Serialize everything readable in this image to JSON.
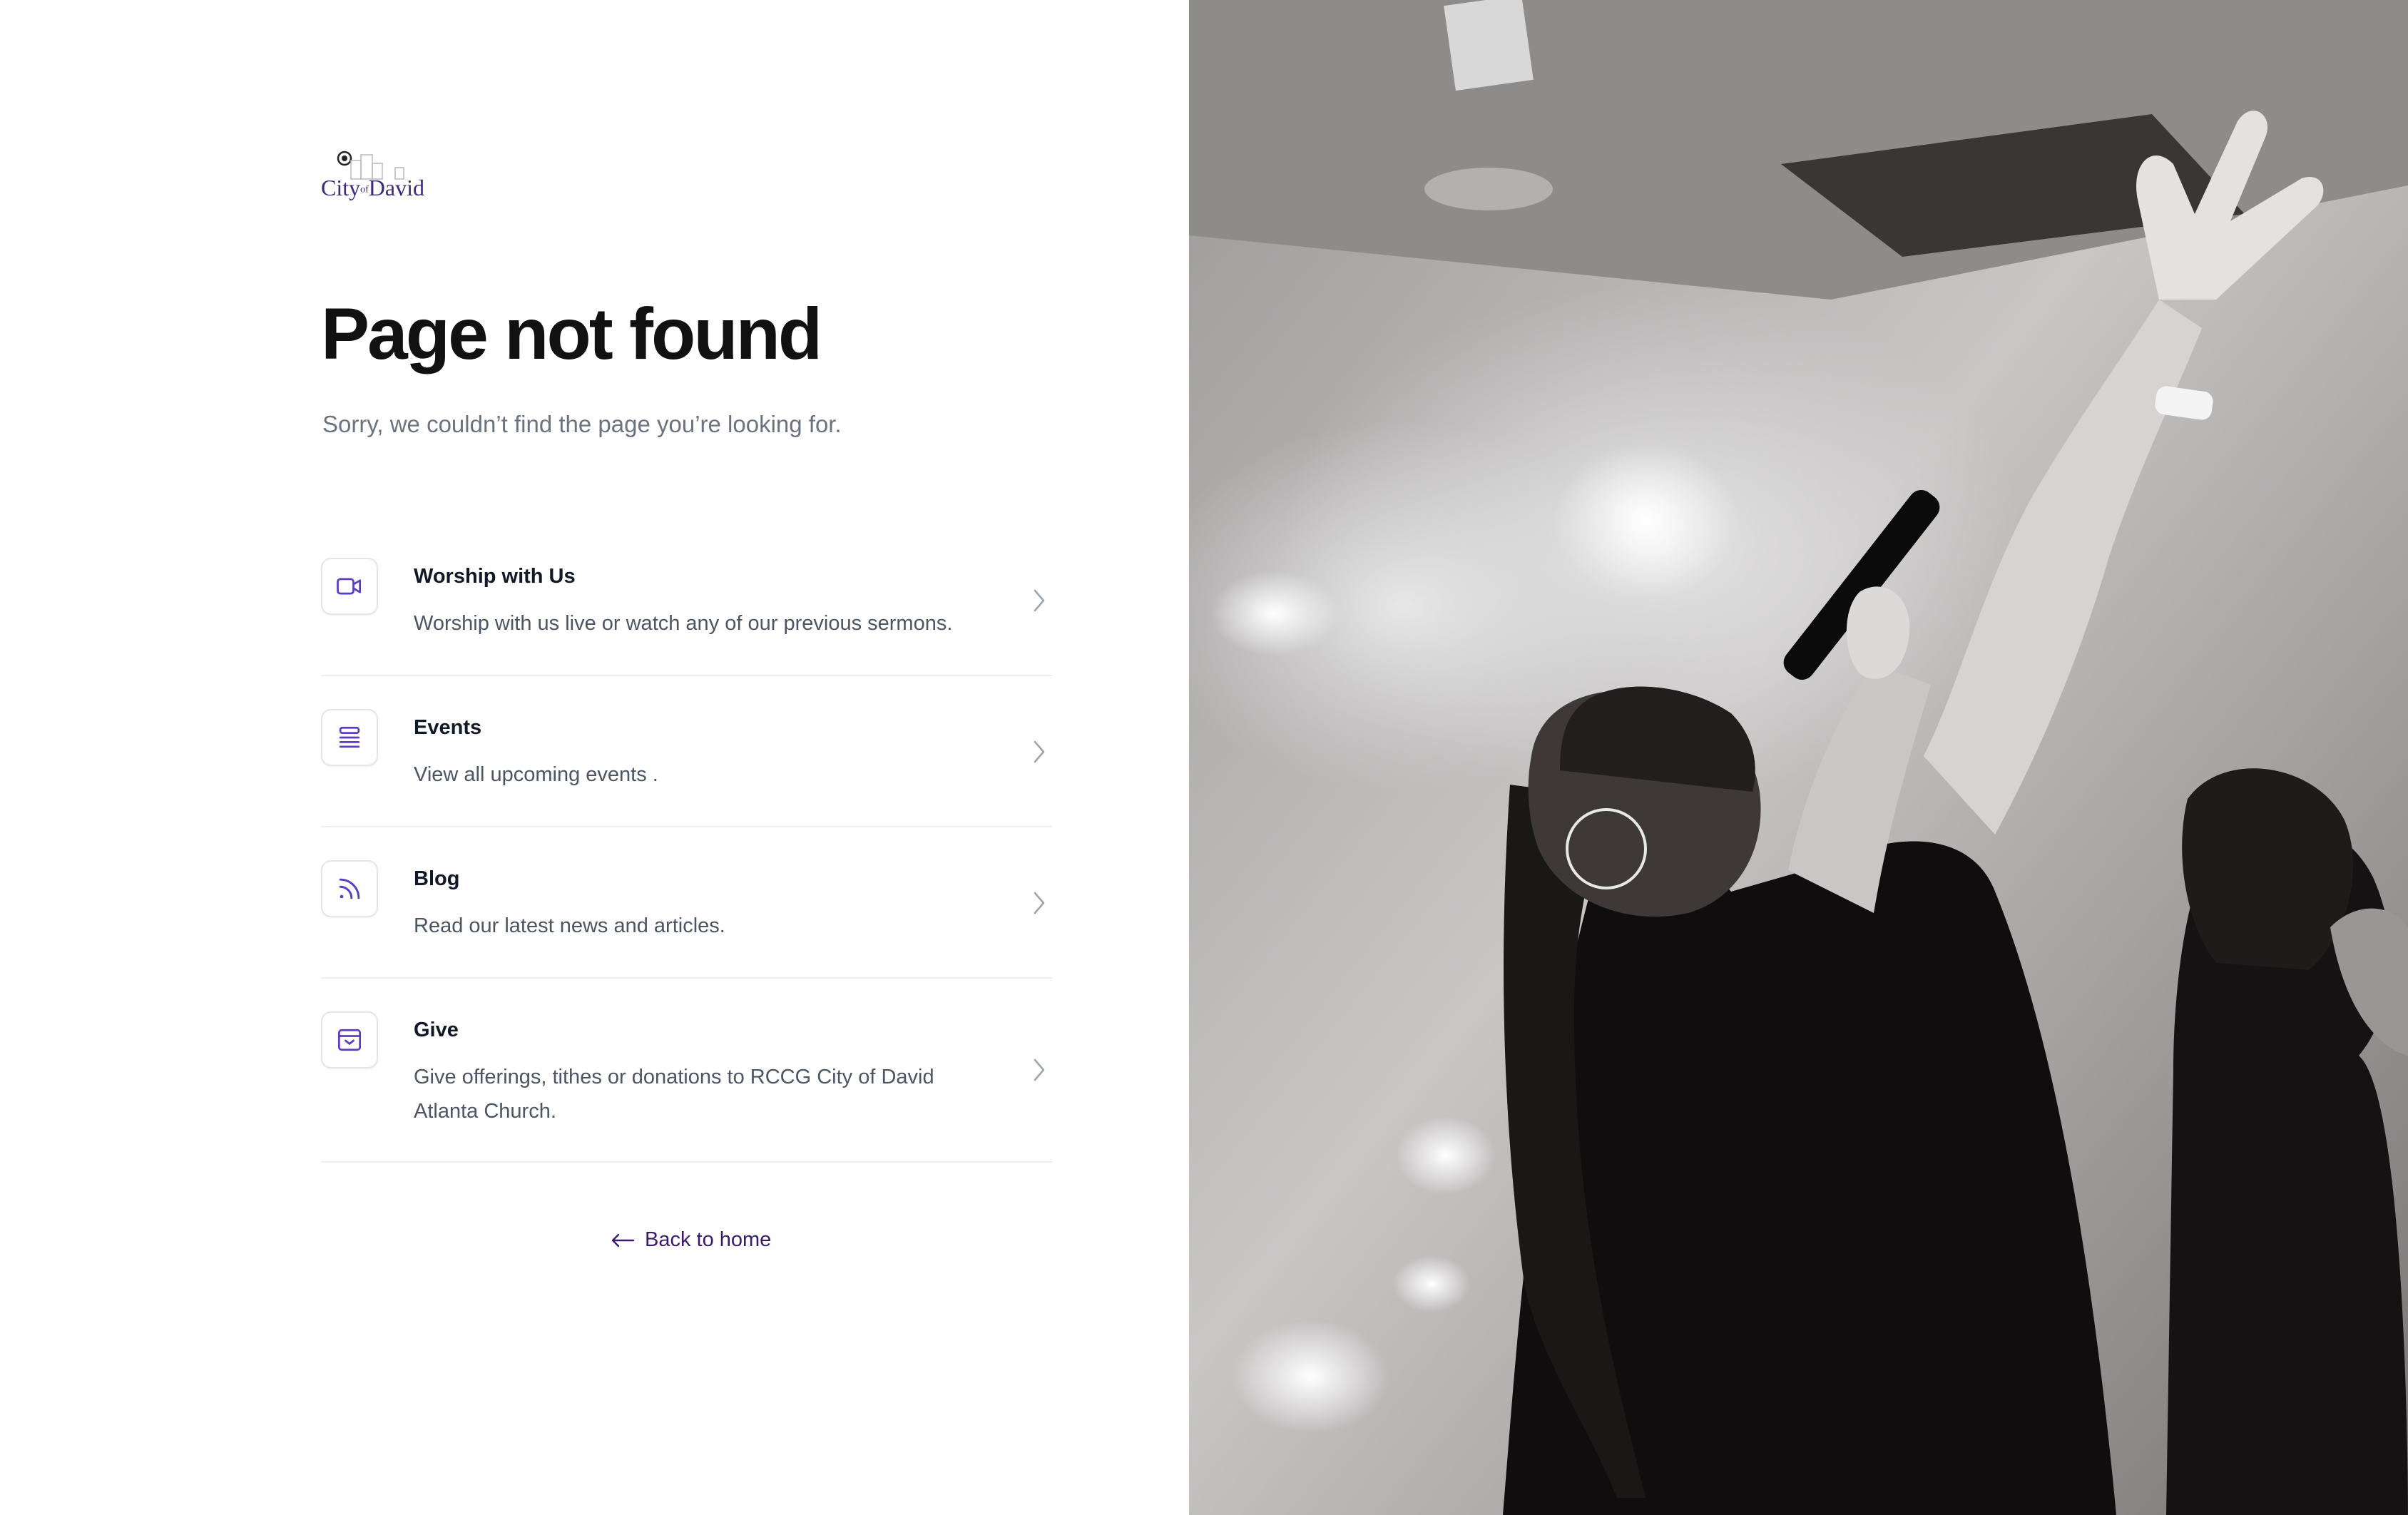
{
  "logo": {
    "name_city": "City",
    "name_of": "of",
    "name_david": "David"
  },
  "page": {
    "title": "Page not found",
    "subtitle": "Sorry, we couldn’t find the page you’re looking for."
  },
  "links": [
    {
      "title": "Worship with Us",
      "description": "Worship with us live or watch any of our previous sermons.",
      "icon": "video-camera-icon"
    },
    {
      "title": "Events",
      "description": "View all upcoming events .",
      "icon": "list-icon"
    },
    {
      "title": "Blog",
      "description": "Read our latest news and articles.",
      "icon": "rss-icon"
    },
    {
      "title": "Give",
      "description": "Give offerings, tithes or donations to RCCG City of David Atlanta Church.",
      "icon": "gift-box-icon"
    }
  ],
  "back_link": {
    "label": "Back to home",
    "icon": "arrow-left-icon"
  },
  "colors": {
    "accent": "#5b3cc4",
    "link": "#3b1a6e",
    "title": "#111111",
    "muted": "#6b7280"
  }
}
